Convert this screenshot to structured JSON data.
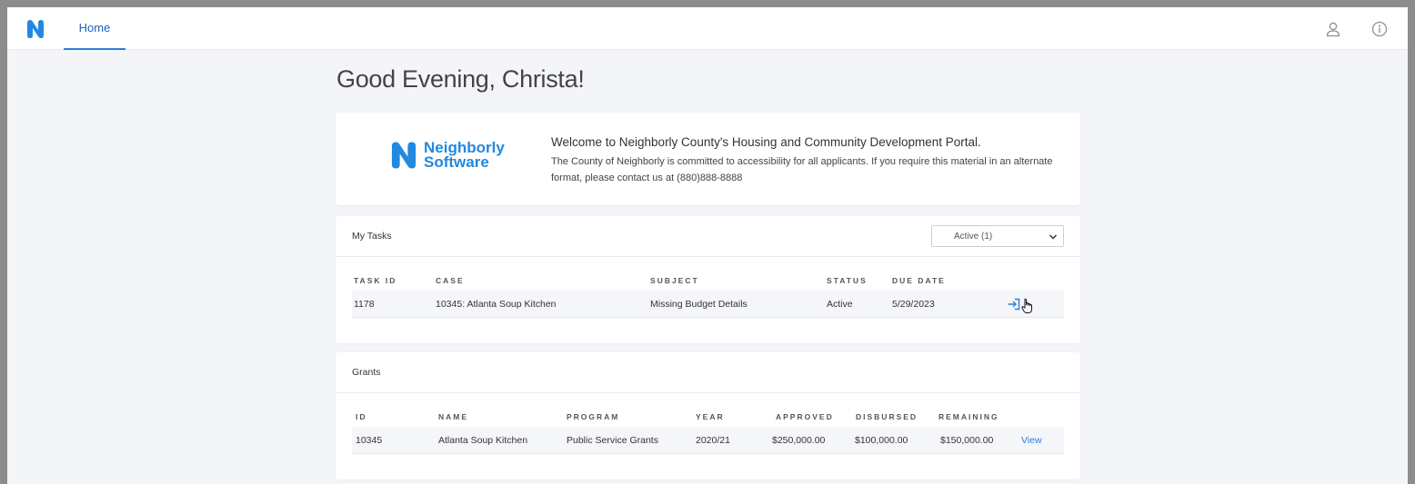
{
  "nav": {
    "home_label": "Home"
  },
  "icons": {
    "logo": "neighborly-n-logo",
    "user": "user-icon",
    "info": "info-icon"
  },
  "colors": {
    "brand": "#2288e0",
    "link": "#2d7fd8",
    "background": "#f3f5f9"
  },
  "greeting": "Good Evening, Christa!",
  "welcome": {
    "logo_line1": "Neighborly",
    "logo_line2": "Software",
    "title": "Welcome to Neighborly County's Housing and Community Development Portal.",
    "body": "The County of Neighborly is committed to accessibility for all applicants. If you require this material in an alternate format, please contact us at (880)888-8888"
  },
  "tasks": {
    "header": "My Tasks",
    "filter": {
      "selected": "Active (1)"
    },
    "columns": [
      "TASK ID",
      "CASE",
      "SUBJECT",
      "STATUS",
      "DUE DATE"
    ],
    "rows": [
      {
        "task_id": "1178",
        "case": "10345: Atlanta Soup Kitchen",
        "subject": "Missing Budget Details",
        "status": "Active",
        "due_date": "5/29/2023"
      }
    ]
  },
  "grants": {
    "header": "Grants",
    "columns": [
      "ID",
      "NAME",
      "PROGRAM",
      "YEAR",
      "APPROVED",
      "DISBURSED",
      "REMAINING"
    ],
    "rows": [
      {
        "id": "10345",
        "name": "Atlanta Soup Kitchen",
        "program": "Public Service Grants",
        "year": "2020/21",
        "approved": "$250,000.00",
        "disbursed": "$100,000.00",
        "remaining": "$150,000.00",
        "action": "View"
      }
    ]
  }
}
